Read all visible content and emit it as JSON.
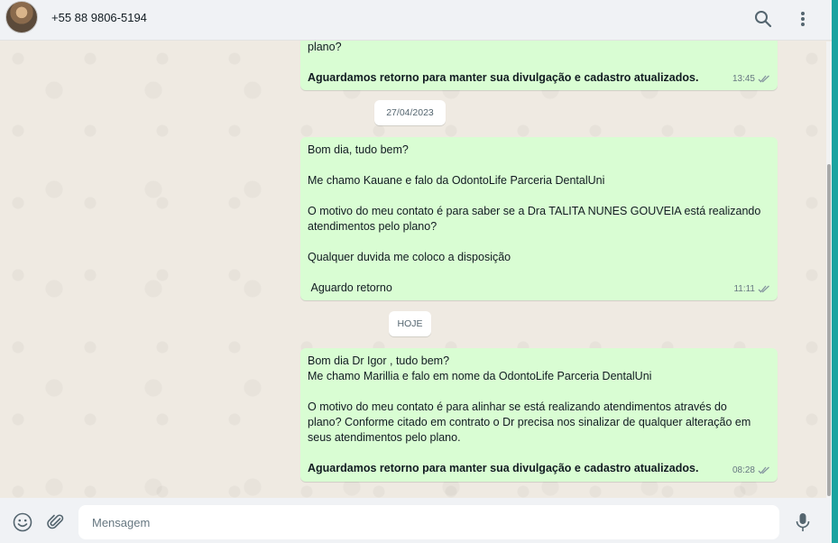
{
  "header": {
    "contact_name": "+55 88 9806-5194"
  },
  "chat": {
    "msg1": {
      "lines": [
        "plano?",
        "",
        "Aguardamos retorno para manter sua divulgação e cadastro atualizados."
      ],
      "time": "13:45"
    },
    "date1": "27/04/2023",
    "msg2": {
      "lines": [
        "Bom dia, tudo bem?",
        "",
        "Me chamo Kauane e falo da OdontoLife Parceria DentalUni",
        "",
        "O motivo do meu contato é para saber se a Dra TALITA NUNES GOUVEIA está realizando",
        "atendimentos pelo plano?",
        "",
        "Qualquer duvida me coloco a disposição",
        "",
        " Aguardo retorno"
      ],
      "time": "11:11"
    },
    "date2": "HOJE",
    "msg3": {
      "lines": [
        "Bom dia Dr Igor , tudo bem?",
        "Me chamo Marillia e falo em nome da OdontoLife Parceria DentalUni",
        "",
        "O motivo do meu contato é para alinhar se está realizando atendimentos através do",
        "plano? Conforme citado em contrato o Dr precisa nos sinalizar de qualquer alteração em",
        "seus atendimentos pelo plano.",
        "",
        "Aguardamos retorno para manter sua divulgação e cadastro atualizados."
      ],
      "time": "08:28"
    }
  },
  "footer": {
    "placeholder": "Mensagem"
  },
  "icons": {
    "search": "search-icon",
    "menu": "menu-icon",
    "emoji": "emoji-icon",
    "attach": "attach-icon",
    "mic": "mic-icon",
    "read": "double-check-icon"
  },
  "colors": {
    "bubble_out": "#d9fdd3",
    "chat_bg": "#efeae2",
    "header_bg": "#f0f2f5",
    "accent": "#1aa3a0"
  }
}
